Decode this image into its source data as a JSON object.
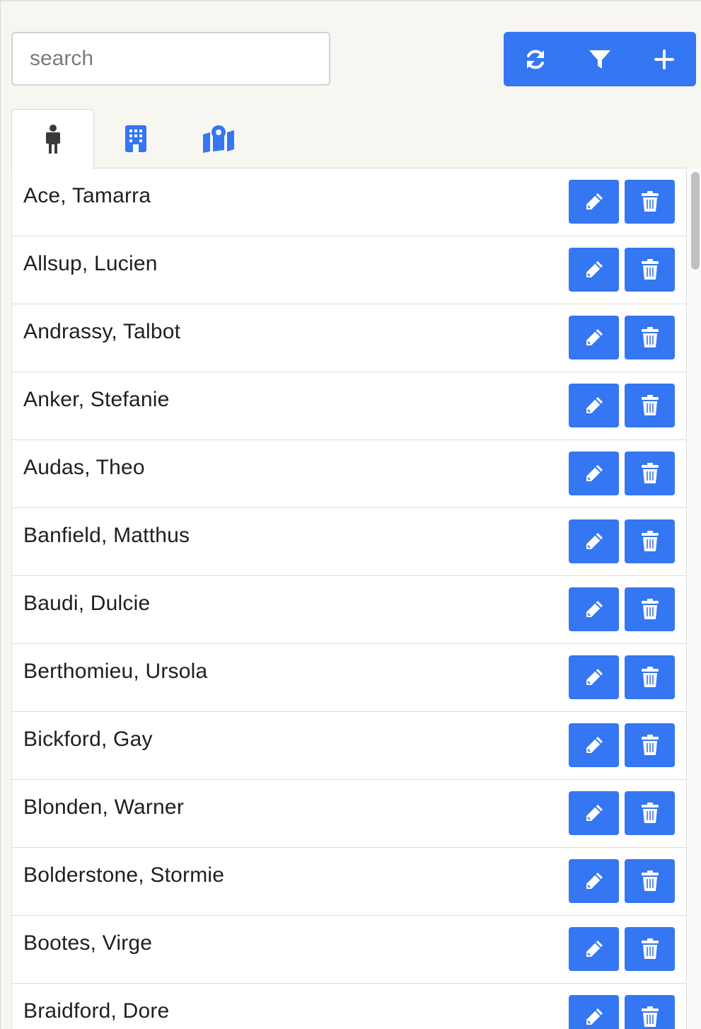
{
  "search": {
    "placeholder": "search",
    "value": ""
  },
  "toolbar": {
    "refresh_icon": "refresh-icon",
    "filter_icon": "filter-icon",
    "add_icon": "plus-icon"
  },
  "tabs": [
    {
      "icon": "person-icon",
      "active": true
    },
    {
      "icon": "building-icon",
      "active": false
    },
    {
      "icon": "map-location-icon",
      "active": false
    }
  ],
  "people": [
    {
      "name": "Ace, Tamarra"
    },
    {
      "name": "Allsup, Lucien"
    },
    {
      "name": "Andrassy, Talbot"
    },
    {
      "name": "Anker, Stefanie"
    },
    {
      "name": "Audas, Theo"
    },
    {
      "name": "Banfield, Matthus"
    },
    {
      "name": "Baudi, Dulcie"
    },
    {
      "name": "Berthomieu, Ursola"
    },
    {
      "name": "Bickford, Gay"
    },
    {
      "name": "Blonden, Warner"
    },
    {
      "name": "Bolderstone, Stormie"
    },
    {
      "name": "Bootes, Virge"
    },
    {
      "name": "Braidford, Dore"
    }
  ],
  "colors": {
    "accent": "#3576f2",
    "page_background": "#f8f6f1",
    "row_text": "#1f1f1f"
  }
}
